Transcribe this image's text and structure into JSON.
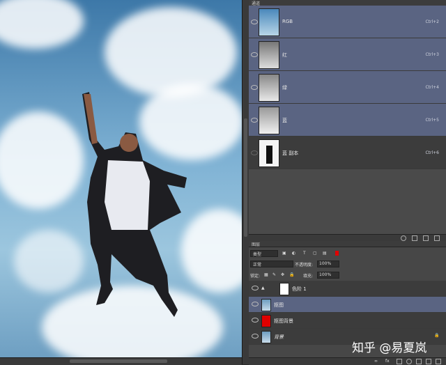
{
  "channels_panel": {
    "tab_label": "通道",
    "channels": [
      {
        "name": "RGB",
        "shortcut": "Ctrl+2",
        "selected": true
      },
      {
        "name": "红",
        "shortcut": "Ctrl+3",
        "selected": true
      },
      {
        "name": "绿",
        "shortcut": "Ctrl+4",
        "selected": true
      },
      {
        "name": "蓝",
        "shortcut": "Ctrl+5",
        "selected": true
      },
      {
        "name": "蓝 副本",
        "shortcut": "Ctrl+6",
        "selected": false
      }
    ]
  },
  "layers_panel": {
    "tab_label": "图层",
    "filter_kind": "类型",
    "blend_mode": "正常",
    "opacity_label": "不透明度:",
    "opacity_value": "100%",
    "lock_label": "锁定:",
    "fill_label": "填充:",
    "fill_value": "100%",
    "layers": [
      {
        "name": "色阶 1",
        "thumb_color": "#ffffff"
      },
      {
        "name": "抠图",
        "thumb_color": "#8fb4cf"
      },
      {
        "name": "抠图背景",
        "thumb_color": "#e00000"
      },
      {
        "name": "背景",
        "thumb_color": "#8fb4cf"
      }
    ]
  },
  "watermark": "知乎 @易夏岚",
  "colors": {
    "selection": "#5a6482",
    "panel": "#3c3c3c",
    "red_fill": "#e00000"
  }
}
